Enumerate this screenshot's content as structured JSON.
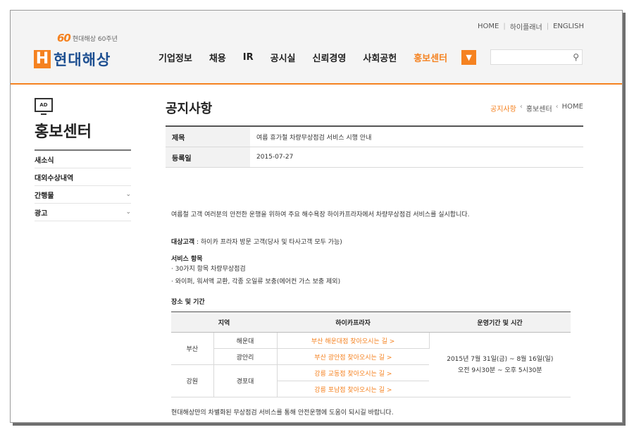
{
  "header": {
    "anniversary_num": "60",
    "anniversary_text": "현대해상 60주년",
    "logo_mark": "H",
    "logo_name": "현대해상",
    "util_links": [
      "HOME",
      "하이플래너",
      "ENGLISH"
    ],
    "nav": [
      "기업정보",
      "채용",
      "IR",
      "공시실",
      "신뢰경영",
      "사회공헌",
      "홍보센터"
    ],
    "nav_active": "홍보센터",
    "more_icon": "chevron-down",
    "search_placeholder": "",
    "search_icon": "search",
    "accent_color": "#f58220",
    "brand_color": "#1d4f91"
  },
  "sidebar": {
    "icon": "monitor-icon",
    "icon_text": "AD",
    "title": "홍보센터",
    "items": [
      {
        "label": "새소식",
        "chevron": ""
      },
      {
        "label": "대외수상내역",
        "chevron": ""
      },
      {
        "label": "간행물",
        "chevron": "⌄"
      },
      {
        "label": "광고",
        "chevron": "⌄"
      }
    ]
  },
  "main": {
    "title": "공지사항",
    "breadcrumb": [
      "공지사항",
      "홍보센터",
      "HOME"
    ],
    "meta": [
      {
        "label": "제목",
        "value": "여름 휴가철 차량무상점검 서비스 시행 안내"
      },
      {
        "label": "등록일",
        "value": "2015-07-27"
      }
    ],
    "intro": "여름철 고객 여러분의 안전한 운행을 위하여 주요 해수욕장 하이카프라자에서 차량무상점검 서비스를 실시합니다.",
    "target_label": "대상고객",
    "target_value": " : 하이카 프라자 방문 고객(당사 및 타사고객 모두 가능)",
    "service_label": "서비스 항목",
    "service_items": [
      "· 30가지 항목 차량무상점검",
      "· 와이퍼, 워셔액 교환, 각종 오일류 보충(에어컨 가스 보충 제외)"
    ],
    "place_label": "장소 및 기간",
    "table": {
      "headers": [
        "지역",
        "하이카프라자",
        "운영기간 및 시간"
      ],
      "regions": [
        "부산",
        "강원"
      ],
      "branches": [
        "해운대",
        "광안리",
        "경포대"
      ],
      "links": [
        "부산 해운대점 찾아오시는 길 >",
        "부산 광안점 찾아오시는 길 >",
        "강릉 교동점 찾아오시는 길 >",
        "강릉 포남점 찾아오시는 길 >"
      ],
      "period": "2015년 7월 31일(금) ~ 8월 16일(일)",
      "hours": "오전 9시30분 ~ 오후 5시30분"
    },
    "closing": "현대해상만의 차별화된 무상점검 서비스를 통해 안전운행에 도움이 되시길 바랍니다."
  }
}
